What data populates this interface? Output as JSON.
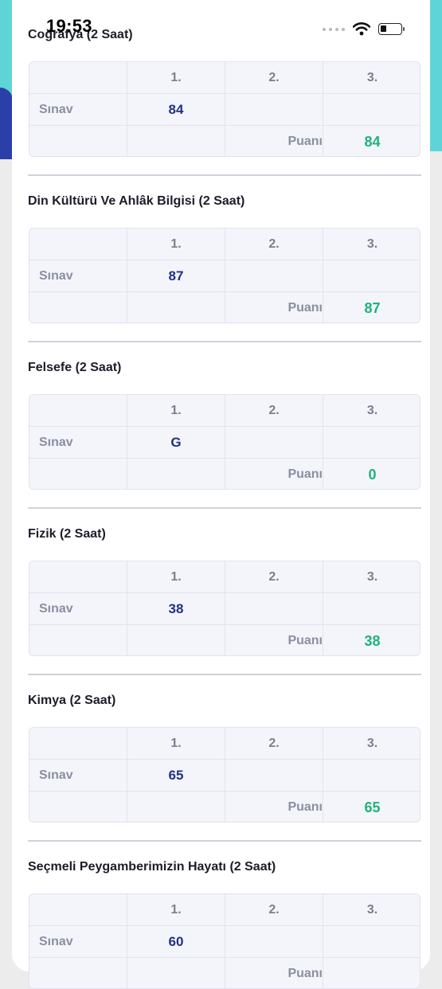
{
  "status_bar": {
    "time": "19:53"
  },
  "table_headers": [
    "1.",
    "2.",
    "3."
  ],
  "row_label": "Sınav",
  "score_label": "Puanı",
  "courses": [
    {
      "title": "Coğrafya (2 Saat)",
      "exams": [
        "84",
        "",
        ""
      ],
      "score": "84"
    },
    {
      "title": "Din Kültürü Ve Ahlâk Bilgisi (2 Saat)",
      "exams": [
        "87",
        "",
        ""
      ],
      "score": "87"
    },
    {
      "title": "Felsefe (2 Saat)",
      "exams": [
        "G",
        "",
        ""
      ],
      "score": "0"
    },
    {
      "title": "Fizik (2 Saat)",
      "exams": [
        "38",
        "",
        ""
      ],
      "score": "38"
    },
    {
      "title": "Kimya (2 Saat)",
      "exams": [
        "65",
        "",
        ""
      ],
      "score": "65"
    },
    {
      "title": "Seçmeli Peygamberimizin Hayatı (2 Saat)",
      "exams": [
        "60",
        "",
        ""
      ],
      "score": ""
    }
  ],
  "colors": {
    "accent_cyan": "#5fd4d8",
    "accent_blue": "#2b3fa8",
    "exam_score": "#1f3183",
    "total_score": "#1eb37a"
  }
}
